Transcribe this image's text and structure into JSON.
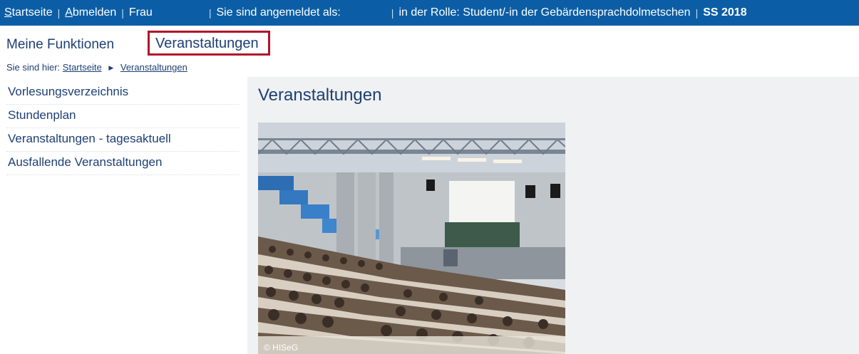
{
  "topbar": {
    "home_link": "Startseite",
    "logout_link": "Abmelden",
    "user_prefix": "Frau",
    "logged_in_label": "Sie sind angemeldet als:",
    "role_label": "in der Rolle: Student/-in der Gebärdensprachdolmetschen",
    "term": "SS 2018",
    "colors": {
      "bar": "#0b5ea5",
      "text": "#ffffff"
    }
  },
  "functions": {
    "my_functions": "Meine Funktionen",
    "events_tab": "Veranstaltungen",
    "highlight_color": "#b1132b"
  },
  "breadcrumb": {
    "prefix": "Sie sind hier:",
    "items": [
      "Startseite",
      "Veranstaltungen"
    ]
  },
  "sidebar": {
    "items": [
      {
        "label": "Vorlesungsverzeichnis"
      },
      {
        "label": "Stundenplan"
      },
      {
        "label": "Veranstaltungen - tagesaktuell"
      },
      {
        "label": "Ausfallende Veranstaltungen"
      }
    ]
  },
  "main": {
    "title": "Veranstaltungen",
    "image_copyright": "© HISeG"
  }
}
